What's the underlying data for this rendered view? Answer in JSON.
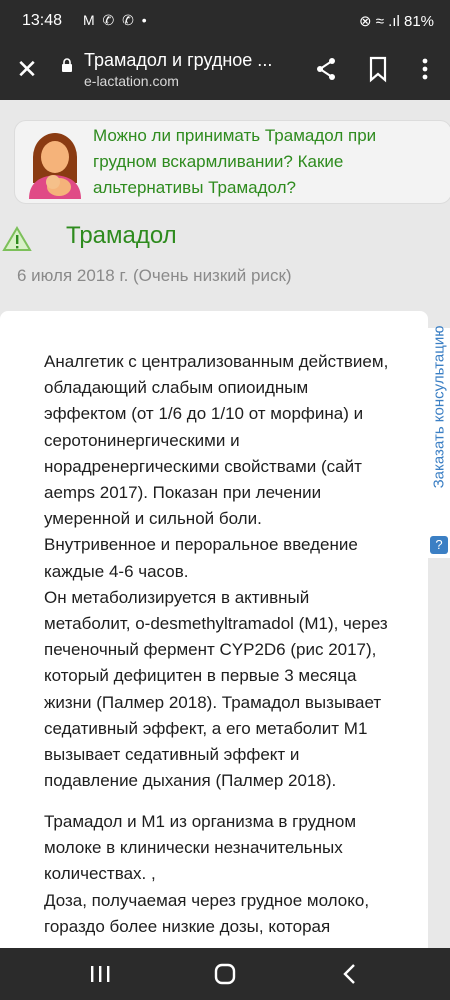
{
  "status_bar": {
    "time": "13:48",
    "left_icons": "M ✆ ✆ •",
    "right_text": "⊗ ≈ .ıl 81%",
    "battery": "81%"
  },
  "toolbar": {
    "title": "Трамадол и грудное ...",
    "url": "e-lactation.com",
    "icons": [
      "close-icon",
      "lock-icon",
      "share-icon",
      "bookmark-icon",
      "more-vert-icon"
    ]
  },
  "question_card": {
    "text": "Можно ли принимать Трамадол при грудном вскармливании? Какие альтернативы Трамадол?",
    "colors": {
      "text": "#2e8b1e"
    }
  },
  "drug": {
    "name": "Трамадол",
    "date": "6 июля 2018 г. (Очень низкий риск)",
    "risk_icon": "warning-triangle-icon"
  },
  "content": {
    "paragraph1": [
      "Аналгетик с централизованным действием,",
      "обладающий слабым опиоидным",
      "эффектом (от 1/6 до 1/10 от морфина) и",
      "серотонинергическими и",
      "норадренергическими свойствами (сайт",
      "aemps 2017). Показан при лечении",
      "умеренной и сильной боли.",
      "Внутривенное и пероральное введение",
      "каждые 4-6 часов.",
      "Он метаболизируется в активный",
      "метаболит, o-desmethyltramadol (M1), через",
      "печеночный фермент CYP2D6 (рис 2017),",
      "который дефицитен в первые 3 месяца",
      "жизни (Палмер 2018). Трамадол вызывает",
      "седативный эффект, а его метаболит M1",
      "вызывает седативный эффект и",
      "подавление дыхания (Палмер 2018)."
    ],
    "paragraph2": [
      "Трамадол и M1 из организма в грудном",
      "молоке в клинически незначительных",
      "количествах. ,",
      "Доза, получаемая через грудное молоко,",
      "гораздо более низкие дозы, которая"
    ]
  },
  "consult_button": {
    "label": "Заказать консультацию",
    "icon_text": "?"
  },
  "navbar": {
    "icons": [
      "recents-icon",
      "home-icon",
      "back-icon"
    ]
  }
}
